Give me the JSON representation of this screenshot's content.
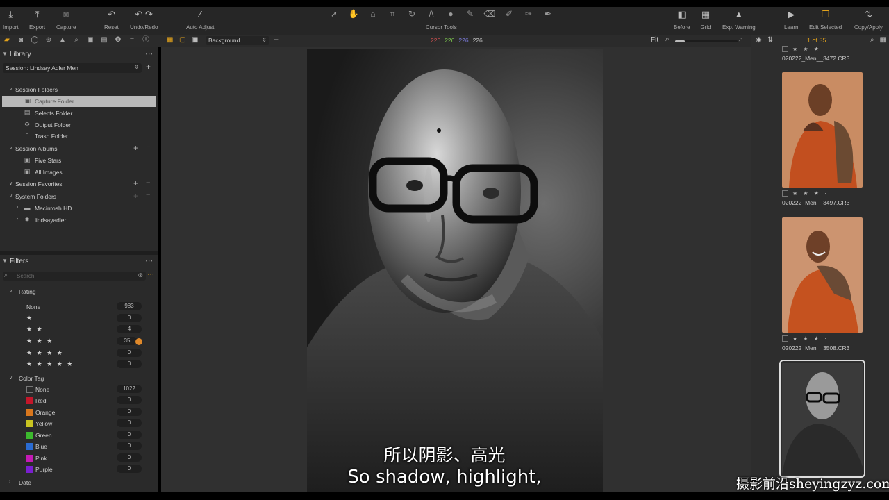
{
  "toolbar": {
    "import": "Import",
    "export": "Export",
    "capture": "Capture",
    "reset": "Reset",
    "undo_redo": "Undo/Redo",
    "auto_adjust": "Auto Adjust",
    "cursor_tools": "Cursor Tools",
    "before": "Before",
    "grid": "Grid",
    "exp_warning": "Exp. Warning",
    "learn": "Learn",
    "edit_selected": "Edit Selected",
    "copy_apply": "Copy/Apply"
  },
  "library": {
    "title": "Library",
    "session": "Session: Lindsay Adler Men",
    "session_folders": "Session Folders",
    "folders": [
      "Capture Folder",
      "Selects Folder",
      "Output Folder",
      "Trash Folder"
    ],
    "session_albums": "Session Albums",
    "albums": [
      "Five Stars",
      "All Images"
    ],
    "session_favorites": "Session Favorites",
    "system_folders": "System Folders",
    "system": [
      "Macintosh HD",
      "lindsayadler"
    ]
  },
  "filters": {
    "title": "Filters",
    "search_placeholder": "Search",
    "rating_title": "Rating",
    "ratings": [
      {
        "label": "None",
        "count": "983"
      },
      {
        "label": "★",
        "count": "0"
      },
      {
        "label": "★ ★",
        "count": "4"
      },
      {
        "label": "★ ★ ★",
        "count": "35"
      },
      {
        "label": "★ ★ ★ ★",
        "count": "0"
      },
      {
        "label": "★ ★ ★ ★ ★",
        "count": "0"
      }
    ],
    "color_tag_title": "Color Tag",
    "color_tags": [
      {
        "label": "None",
        "count": "1022",
        "color": "#2a2a2a"
      },
      {
        "label": "Red",
        "count": "0",
        "color": "#c4162a"
      },
      {
        "label": "Orange",
        "count": "0",
        "color": "#d9771d"
      },
      {
        "label": "Yellow",
        "count": "0",
        "color": "#c9c421"
      },
      {
        "label": "Green",
        "count": "0",
        "color": "#3cb92e"
      },
      {
        "label": "Blue",
        "count": "0",
        "color": "#2a6bd1"
      },
      {
        "label": "Pink",
        "count": "0",
        "color": "#c41ab5"
      },
      {
        "label": "Purple",
        "count": "0",
        "color": "#7a1fd0"
      }
    ],
    "date_title": "Date"
  },
  "viewer": {
    "layer": "Background",
    "rgb": [
      "226",
      "226",
      "226",
      "226"
    ],
    "zoom": "Fit"
  },
  "browser": {
    "count": "1 of 35",
    "thumbs": [
      {
        "file": "020222_Men__3472.CR3",
        "stars": "★ ★ ★ · ·"
      },
      {
        "file": "020222_Men__3497.CR3",
        "stars": "★ ★ ★ · ·"
      },
      {
        "file": "020222_Men__3508.CR3",
        "stars": "★ ★ ★ · ·"
      }
    ]
  },
  "subtitles": {
    "cn": "所以阴影、高光",
    "en": "So shadow, highlight,"
  },
  "watermark": "摄影前沿sheyingzyz.com",
  "colors": {
    "accent": "#e2a21b"
  }
}
